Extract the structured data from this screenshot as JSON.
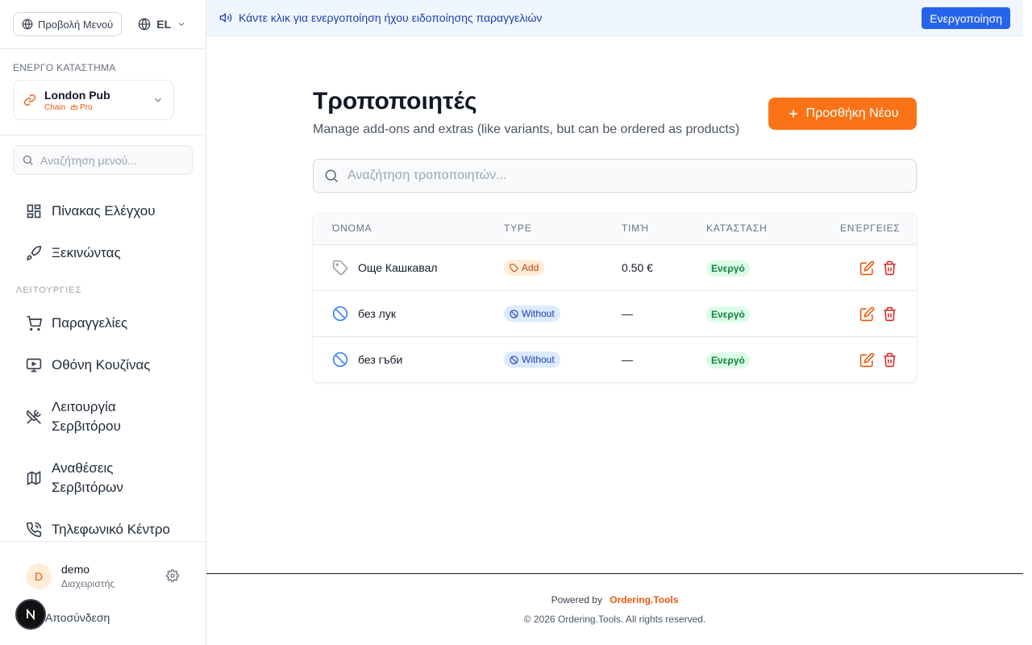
{
  "sidebar": {
    "menu_button": "Προβολή Μενού",
    "language": "EL",
    "active_store_caption": "ΕΝΕΡΓΟ ΚΑΤΑΣΤΗΜΑ",
    "store": {
      "name": "London Pub",
      "type": "Chain",
      "plan": "Pro"
    },
    "search_placeholder": "Αναζήτηση μενού...",
    "nav_top": [
      {
        "label": "Πίνακας Ελέγχου",
        "icon": "dashboard-icon"
      },
      {
        "label": "Ξεκινώντας",
        "icon": "rocket-icon"
      }
    ],
    "section_caption": "ΛΕΙΤΟΥΡΓΙΕΣ",
    "nav_functions": [
      {
        "label": "Παραγγελίες",
        "icon": "cart-icon"
      },
      {
        "label": "Οθόνη Κουζίνας",
        "icon": "monitor-icon"
      },
      {
        "label": "Λειτουργία Σερβιτόρου",
        "icon": "utensils-crossed-icon"
      },
      {
        "label": "Αναθέσεις Σερβιτόρων",
        "icon": "map-icon"
      },
      {
        "label": "Τηλεφωνικό Κέντρο",
        "icon": "phone-icon"
      }
    ],
    "user": {
      "initial": "D",
      "name": "demo",
      "role": "Διαχειριστής"
    },
    "logout": "Αποσύνδεση",
    "dev_badge": "N"
  },
  "banner": {
    "text": "Κάντε κλικ για ενεργοποίηση ήχου ειδοποίησης παραγγελιών",
    "button": "Ενεργοποίηση"
  },
  "main": {
    "title": "Τροποποιητές",
    "subtitle": "Manage add-ons and extras (like variants, but can be ordered as products)",
    "add_button": "Προσθήκη Νέου",
    "search_placeholder": "Αναζήτηση τροποποιητών...",
    "columns": [
      "ΌΝΟΜΑ",
      "TYPE",
      "ΤΙΜΉ",
      "ΚΑΤΆΣΤΑΣΗ",
      "ΕΝΈΡΓΕΙΕΣ"
    ],
    "rows": [
      {
        "name": "Още Кашкавал",
        "type": "Add",
        "price": "0.50 €",
        "status": "Ενεργό",
        "icon": "tag-icon"
      },
      {
        "name": "без лук",
        "type": "Without",
        "price": "—",
        "status": "Ενεργό",
        "icon": "ban-icon"
      },
      {
        "name": "без гъби",
        "type": "Without",
        "price": "—",
        "status": "Ενεργό",
        "icon": "ban-icon"
      }
    ]
  },
  "footer": {
    "powered_by": "Powered by",
    "brand": "Ordering.Tools",
    "copyright": "© 2026 Ordering.Tools. All rights reserved."
  },
  "colors": {
    "accent": "#f97316",
    "banner_bg": "#eff6ff",
    "banner_button": "#2563eb",
    "status_active_bg": "#dcfce7",
    "delete": "#dc2626"
  }
}
